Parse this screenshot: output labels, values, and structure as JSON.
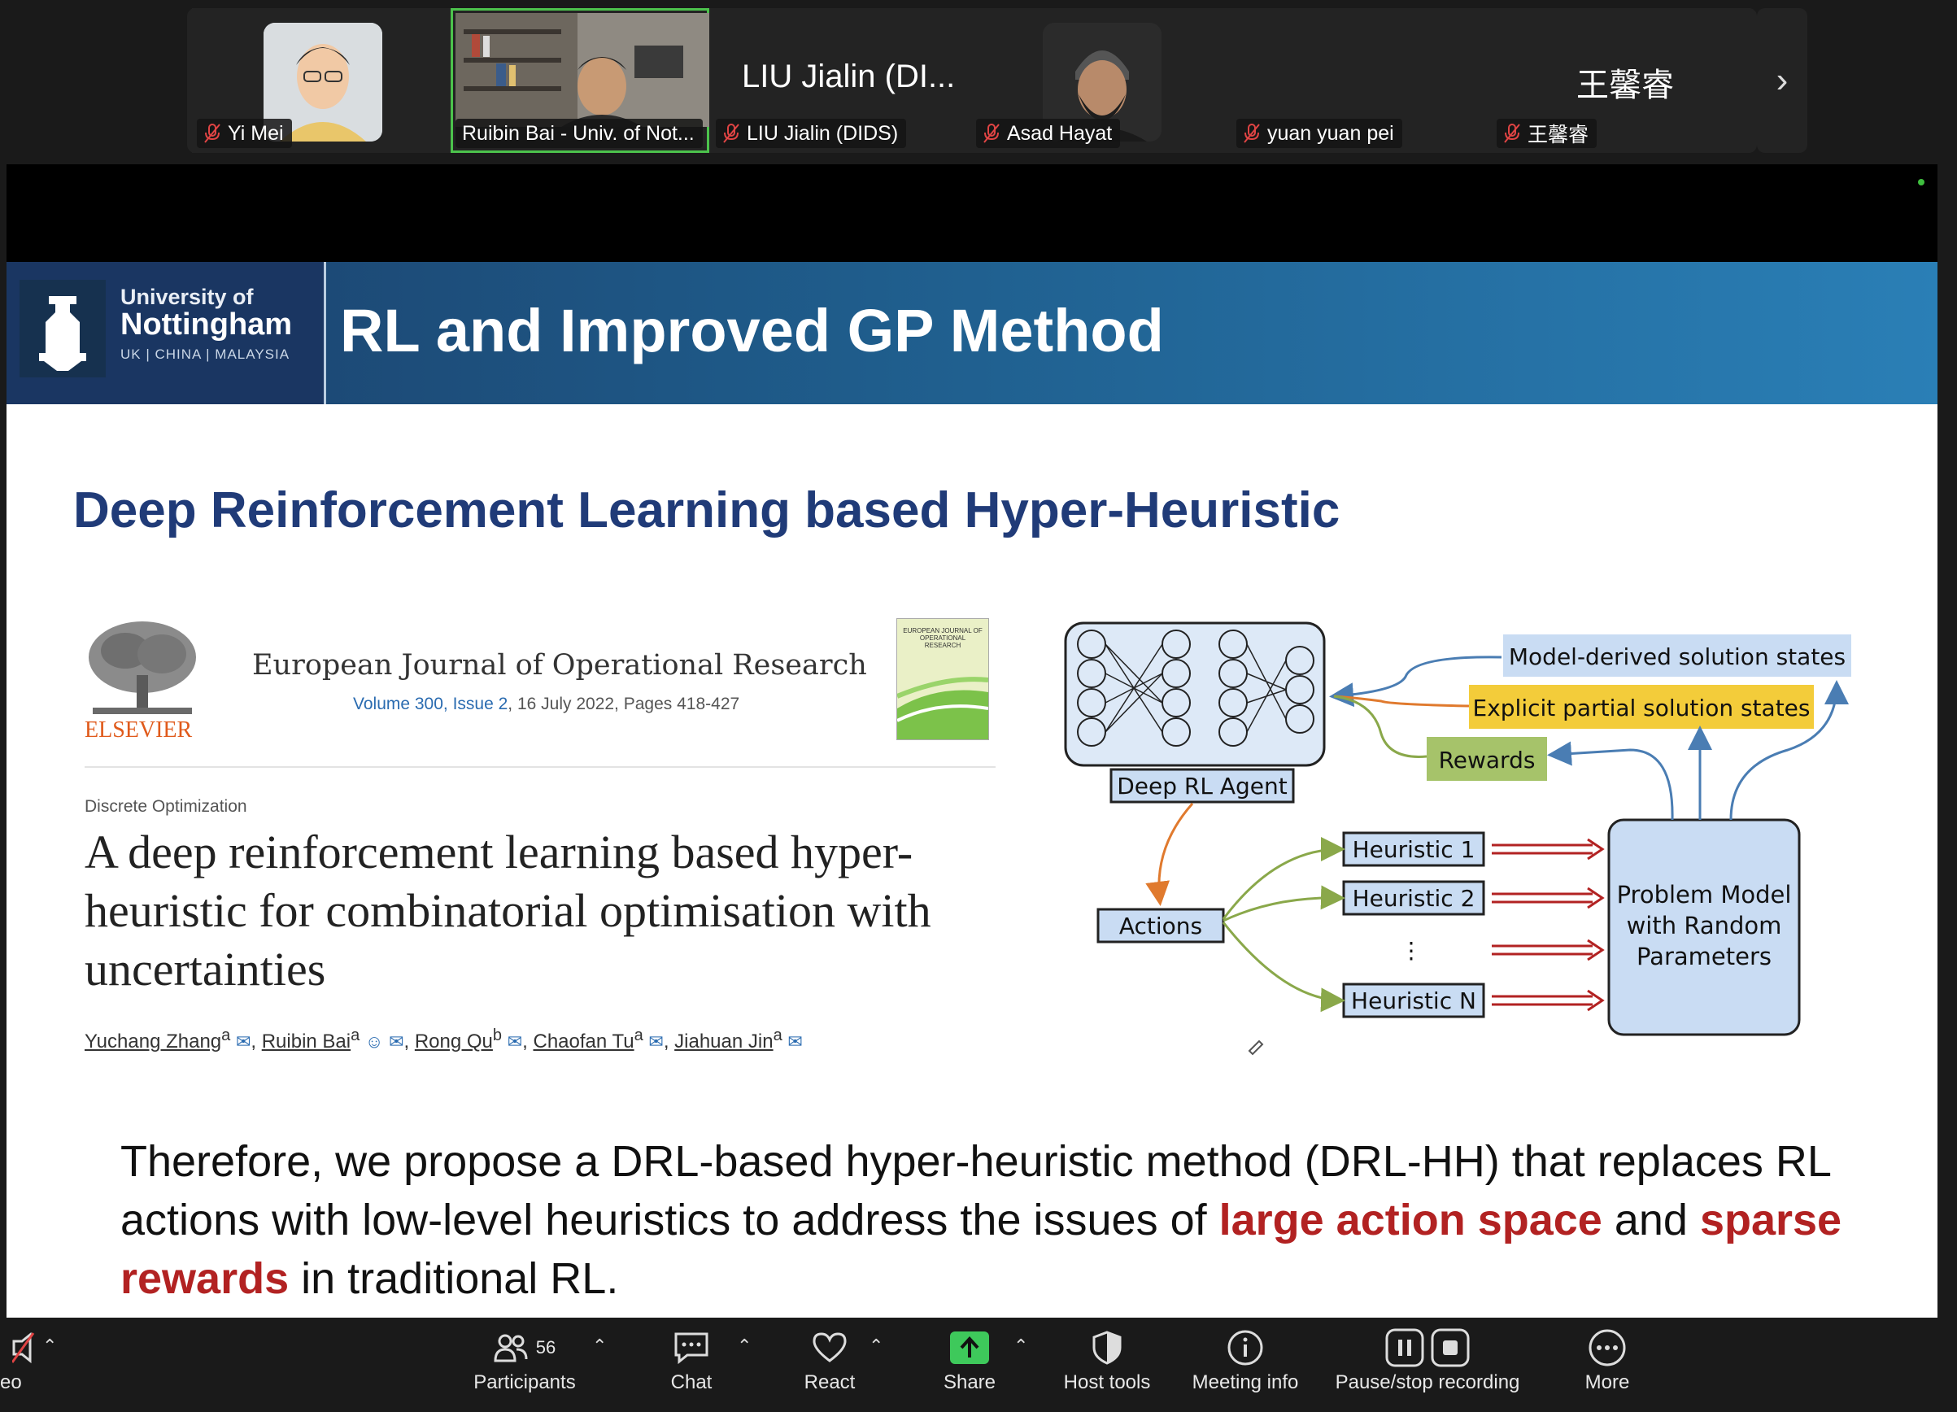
{
  "participants": [
    {
      "name": "Yi Mei",
      "muted": true
    },
    {
      "name": "Ruibin Bai - Univ. of Not...",
      "muted": false
    },
    {
      "name": "LIU Jialin (DIDS)",
      "big_name": "LIU Jialin (DI...",
      "muted": true
    },
    {
      "name": "Asad Hayat",
      "muted": true
    },
    {
      "name": "yuan yuan pei",
      "muted": true
    },
    {
      "name": "王馨睿",
      "big_name": "王馨睿",
      "muted": true
    }
  ],
  "next_icon": "chevron-right-icon",
  "slide": {
    "university": {
      "line1": "University of",
      "line2": "Nottingham",
      "line3": "UK | CHINA | MALAYSIA"
    },
    "title": "RL and Improved GP Method",
    "subtitle": "Deep Reinforcement Learning based Hyper-Heuristic",
    "paper": {
      "publisher": "ELSEVIER",
      "journal": "European Journal of Operational Research",
      "volume": "Volume 300, Issue 2",
      "meta": ", 16 July 2022, Pages 418-427",
      "cover_text": "EUROPEAN JOURNAL OF OPERATIONAL RESEARCH",
      "section": "Discrete Optimization",
      "title": "A deep reinforcement learning based hyper-heuristic for combinatorial optimisation with uncertainties",
      "authors": [
        {
          "name": "Yuchang Zhang",
          "aff": "a"
        },
        {
          "name": "Ruibin Bai",
          "aff": "a"
        },
        {
          "name": "Rong Qu",
          "aff": "b"
        },
        {
          "name": "Chaofan Tu",
          "aff": "a"
        },
        {
          "name": "Jiahuan Jin",
          "aff": "a"
        }
      ]
    },
    "diagram": {
      "agent": "Deep RL Agent",
      "model_states": "Model-derived solution states",
      "explicit_states": "Explicit partial solution states",
      "rewards": "Rewards",
      "actions": "Actions",
      "h1": "Heuristic 1",
      "h2": "Heuristic 2",
      "dots": "⋮",
      "hn": "Heuristic N",
      "problem_l1": "Problem Model",
      "problem_l2": "with Random",
      "problem_l3": "Parameters"
    },
    "body": {
      "p1": "Therefore, we propose a DRL-based hyper-heuristic method (DRL-HH) that replaces RL actions with low-level heuristics to address the issues of ",
      "h1": "large action space",
      "p2": " and ",
      "h2": "sparse rewards",
      "p3": " in traditional RL."
    }
  },
  "toolbar": {
    "video_label": "eo",
    "participants_label": "Participants",
    "participants_count": "56",
    "chat_label": "Chat",
    "react_label": "React",
    "share_label": "Share",
    "host_tools_label": "Host tools",
    "meeting_info_label": "Meeting info",
    "recording_label": "Pause/stop recording",
    "more_label": "More",
    "share_color": "#3ec95b"
  }
}
